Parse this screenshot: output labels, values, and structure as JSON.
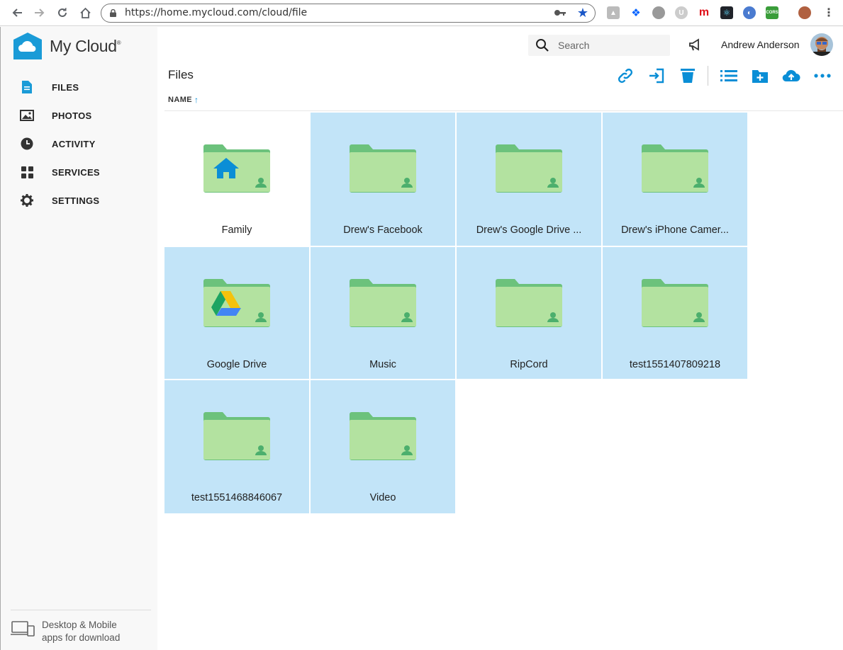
{
  "browser": {
    "url": "https://home.mycloud.com/cloud/file"
  },
  "app": {
    "logo_text": "My Cloud",
    "logo_mark": "®"
  },
  "sidebar": {
    "items": [
      {
        "label": "FILES",
        "icon": "file-icon"
      },
      {
        "label": "PHOTOS",
        "icon": "photo-icon"
      },
      {
        "label": "ACTIVITY",
        "icon": "clock-icon"
      },
      {
        "label": "SERVICES",
        "icon": "grid-icon"
      },
      {
        "label": "SETTINGS",
        "icon": "gear-icon"
      }
    ],
    "apps_line1": "Desktop & Mobile",
    "apps_line2": "apps for download"
  },
  "header": {
    "search_placeholder": "Search",
    "user_name": "Andrew Anderson"
  },
  "main": {
    "title": "Files",
    "sort_label": "NAME",
    "sort_arrow": "↑"
  },
  "colors": {
    "accent": "#0a8ed6",
    "selection": "#c2e4f8",
    "folder": "#b3e2a0",
    "folder_tab": "#6cc27c"
  },
  "folders": [
    {
      "name": "Family",
      "badge": "home",
      "selected": false
    },
    {
      "name": "Drew's Facebook",
      "badge": "",
      "selected": true
    },
    {
      "name": "Drew's Google Drive ...",
      "badge": "",
      "selected": true
    },
    {
      "name": "Drew's iPhone Camer...",
      "badge": "",
      "selected": true
    },
    {
      "name": "Google Drive",
      "badge": "google-drive",
      "selected": true
    },
    {
      "name": "Music",
      "badge": "",
      "selected": true
    },
    {
      "name": "RipCord",
      "badge": "",
      "selected": true
    },
    {
      "name": "test1551407809218",
      "badge": "",
      "selected": true
    },
    {
      "name": "test1551468846067",
      "badge": "",
      "selected": true
    },
    {
      "name": "Video",
      "badge": "",
      "selected": true
    }
  ]
}
